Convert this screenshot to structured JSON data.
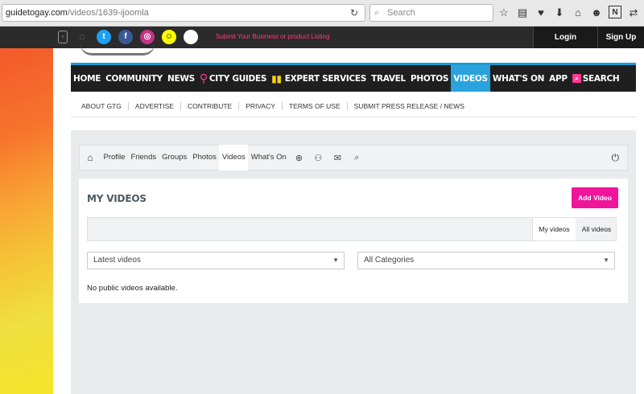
{
  "browser": {
    "url_domain": "guidetogay.com",
    "url_path": "/videos/1639-ijoomla",
    "reload_glyph": "↻",
    "search_placeholder": "Search",
    "search_glyph": "⌕",
    "toolbar_icons": [
      "star-icon",
      "reading-list-icon",
      "pocket-icon",
      "download-icon",
      "home-icon",
      "chat-icon",
      "n-extension-icon",
      "extension-icon"
    ],
    "toolbar_glyphs": [
      "☆",
      "▤",
      "♥",
      "⬇",
      "⌂",
      "☻",
      "N",
      "⇄"
    ]
  },
  "social": {
    "phone_glyph": "▫",
    "android_glyph": "◌",
    "twitter_glyph": "t",
    "facebook_glyph": "f",
    "instagram_glyph": "◎",
    "snapchat_glyph": "☺",
    "submit_text": "Submit Your Business or product Listing",
    "login": "Login",
    "signup": "Sign Up"
  },
  "nav": {
    "items": [
      "HOME",
      "COMMUNITY",
      "NEWS",
      "CITY GUIDES",
      "EXPERT SERVICES",
      "TRAVEL",
      "PHOTOS",
      "VIDEOS",
      "WHAT'S ON",
      "APP",
      "SEARCH"
    ],
    "active": "VIDEOS",
    "pin_glyph": "⚲",
    "book_glyph": "▮▮",
    "search_glyph": "⌕"
  },
  "subnav": {
    "items": [
      "ABOUT GTG",
      "ADVERTISE",
      "CONTRIBUTE",
      "PRIVACY",
      "TERMS OF USE",
      "SUBMIT PRESS RELEASE / NEWS"
    ]
  },
  "toolbar": {
    "home_glyph": "⌂",
    "items": [
      "Profile",
      "Friends",
      "Groups",
      "Photos",
      "Videos",
      "What's On"
    ],
    "active": "Videos",
    "globe_glyph": "⊕",
    "users_glyph": "⚇",
    "mail_glyph": "✉",
    "search_glyph": "⌕",
    "power_glyph": "⏻"
  },
  "videos": {
    "title": "MY VIDEOS",
    "add_button": "Add Video",
    "tab_my": "My videos",
    "tab_all": "All videos",
    "sort_value": "Latest videos",
    "category_value": "All Categories",
    "caret_glyph": "▼",
    "empty_message": "No public videos available."
  }
}
